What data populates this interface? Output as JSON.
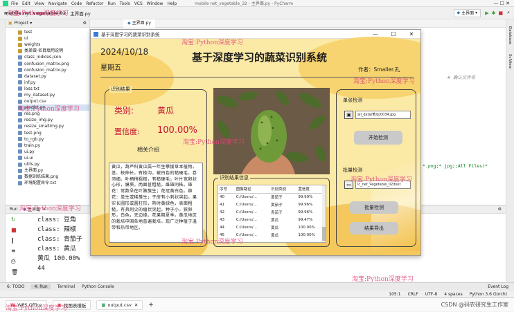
{
  "ide": {
    "menu": [
      "File",
      "Edit",
      "View",
      "Navigate",
      "Code",
      "Refactor",
      "Run",
      "Tools",
      "VCS",
      "Window",
      "Help"
    ],
    "window_title": "mobile net_vegetable_32 - 主界面.py - PyCharm",
    "breadcrumb": "mobile net vegetable 02",
    "breadcrumb_file": "主界面.py",
    "run_config": "主界面",
    "project_header": "Project",
    "editor_tab": "主界面.py",
    "right_strip_labels": [
      "Database",
      "SciView"
    ],
    "code_snippets": {
      "comment": "# 确认文件名",
      "filter": "*.png;*.jpg;;All Files(*"
    },
    "project_tree": [
      {
        "name": "test",
        "type": "folder"
      },
      {
        "name": "ui",
        "type": "folder"
      },
      {
        "name": "weights",
        "type": "folder"
      },
      {
        "name": "类差做-名目填用说明",
        "type": "folder"
      },
      {
        "name": "class_indices.json",
        "type": "file"
      },
      {
        "name": "confusion_matrix.png",
        "type": "file"
      },
      {
        "name": "confusion_matrix.py",
        "type": "file"
      },
      {
        "name": "dataset.py",
        "type": "file"
      },
      {
        "name": "inf.py",
        "type": "file"
      },
      {
        "name": "loss.txt",
        "type": "file"
      },
      {
        "name": "my_dataset.py",
        "type": "file"
      },
      {
        "name": "output.csv",
        "type": "file"
      },
      {
        "name": "predict.py",
        "type": "file"
      },
      {
        "name": "res.png",
        "type": "file"
      },
      {
        "name": "resize_img.py",
        "type": "file"
      },
      {
        "name": "resize_smallimg.py",
        "type": "file"
      },
      {
        "name": "test.png",
        "type": "file"
      },
      {
        "name": "to_rgb.py",
        "type": "file"
      },
      {
        "name": "train.py",
        "type": "file"
      },
      {
        "name": "ui.py",
        "type": "file"
      },
      {
        "name": "ui.ui",
        "type": "file"
      },
      {
        "name": "utils.py",
        "type": "file"
      },
      {
        "name": "主界面.py",
        "type": "file"
      },
      {
        "name": "数据训练结果.png",
        "type": "file"
      },
      {
        "name": "环境配置命令.txt",
        "type": "file"
      }
    ],
    "run_panel": {
      "tab": "主界面",
      "side_label": "Run",
      "lines": [
        "class: 豆角",
        "class: 辣椒",
        "class: 青茄子",
        "class: 黄瓜",
        "黄瓜 100.00%",
        "44"
      ]
    },
    "bottom_tabs": [
      "6: TODO",
      "4: Run",
      "Terminal",
      "Python Console"
    ],
    "event_log": "Event Log",
    "status": [
      "105:1",
      "CRLF",
      "UTF-8",
      "4 spaces",
      "Python 3.6 (torch)"
    ],
    "taskbar": {
      "tab1": "WPS Office",
      "tab2": "找图表模板",
      "tab3": "output.csv"
    },
    "csdn": "CSDN @码农研究生工作室"
  },
  "app": {
    "window_title": "基于深度学习的蔬菜识别系统",
    "date": "2024/10/18",
    "weekday": "星期五",
    "title": "基于深度学习的蔬菜识别系统",
    "author": "作者：Smaller.孔",
    "result_panel": {
      "title": "识别结果",
      "class_label": "类别:",
      "class_value": "黄瓜",
      "conf_label": "置信度:",
      "conf_value": "100.00%",
      "intro_title": "相关介绍",
      "intro_text": "黄瓜，葫芦科黄瓜属一年生攀援草本植物。茎、枝伸长，有棱沟，被白色的糙硬毛。卷须细。叶柄稍粗糙，有糙硬毛；叶片宽卵状心形，膜质，两面甚粗糙。雌雄同株。雄花：常数朵在叶腋簇生；花冠黄白色。雌花：单生或稀簇生；子房有小刺状突起。果实长圆形或圆柱形，熟时黄绿色，表面粗糙，有具刺尖的瘤状突起。种子小，狭卵形，白色，无边缘。花果期夏季。黄瓜地区的栽培中国各地普遍栽培，现广泛种植于温带和热带地区。"
    },
    "table": {
      "title": "识别结果信息",
      "headers": [
        "序号",
        "图像路径",
        "识别类别",
        "置信度"
      ],
      "rows": [
        [
          "40",
          "C:/Users/...",
          "黄茄子",
          "99.99%"
        ],
        [
          "41",
          "C:/Users/...",
          "黄茄子",
          "99.96%"
        ],
        [
          "42",
          "C:/Users/...",
          "青茄子",
          "99.96%"
        ],
        [
          "43",
          "C:/Users/...",
          "黄瓜",
          "99.47%"
        ],
        [
          "44",
          "C:/Users/...",
          "黄瓜",
          "100.00%"
        ],
        [
          "45",
          "C:/Users/...",
          "黄瓜",
          "100.00%"
        ]
      ]
    },
    "single": {
      "title": "单张检测",
      "path": "all_data/黄瓜/0034.jpg",
      "button": "开始检测"
    },
    "batch": {
      "title": "批量检测",
      "path": "ic_net_vegetable_02/test",
      "button": "批量检测"
    },
    "export_button": "结果导出"
  },
  "watermarks": [
    "淘宝:Python深度学习"
  ],
  "colors": {
    "accent_red": "#c8102e",
    "app_bg": "#fbe9a6",
    "pink_watermark": "#e0457a"
  }
}
